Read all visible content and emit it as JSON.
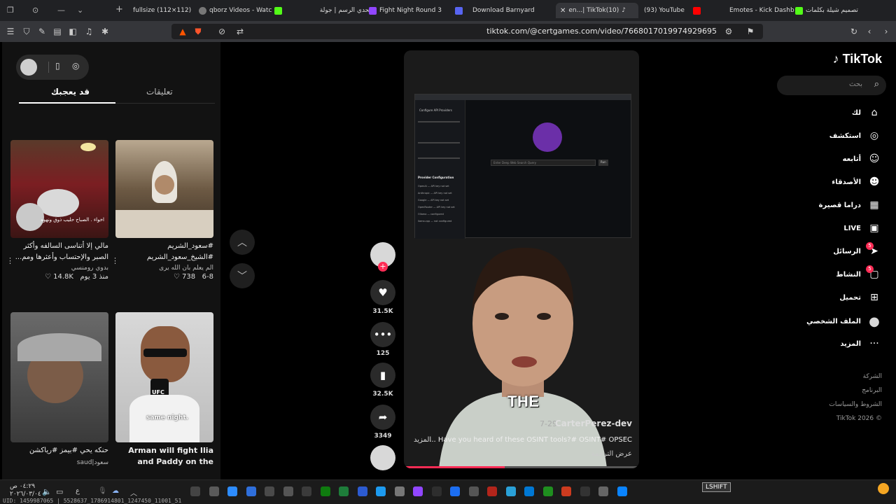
{
  "tabs": [
    {
      "title": "fullsize (112×112)",
      "active": false
    },
    {
      "title": "qborz Videos - Watc",
      "active": false
    },
    {
      "title": "تحدي الرسم | جولة",
      "active": false
    },
    {
      "title": "Fight Night Round 3",
      "active": false
    },
    {
      "title": "Download Barnyard",
      "active": false
    },
    {
      "title": "en...| TikTok(10)",
      "active": true
    },
    {
      "title": "(93) YouTube",
      "active": false
    },
    {
      "title": "Emotes - Kick Dashb",
      "active": false
    },
    {
      "title": "تصميم شيلة بكلمات",
      "active": false
    }
  ],
  "toolbar": {
    "url": "tiktok.com/@certgames.com/video/7668017019974929695"
  },
  "left_panel": {
    "tab_comments": "تعليقات",
    "tab_you_may_like": "قد يعجبك",
    "cards": [
      {
        "caption": "#سعود_الشريم #الشيخ_سعود_الشريم #النفس...",
        "author": "الم يعلم بان الله يرى",
        "likes": "738",
        "date": "6-8"
      },
      {
        "caption": "مالي إلا أتناسى السالفه وأكثر الصبر والإحتساب وأعثرها ومم...",
        "author": "بدوي رومنسي",
        "likes": "14.8K",
        "date": "منذ 3 يوم"
      },
      {
        "caption": "Arman will fight Ilia and Paddy on the same...",
        "author": "",
        "likes": "",
        "date": ""
      },
      {
        "caption": "حنكه يحي #بيمز #رياكشن",
        "author": "سعود|saud",
        "likes": "",
        "date": ""
      }
    ],
    "thumb_texts": {
      "card2": "اخواء . الصباح حليب ذوق ونهوه",
      "card3": "same night.",
      "card3_brand": "UFC"
    }
  },
  "video": {
    "author": "CarterPerez-dev",
    "date": "7-29",
    "description": "Have you heard of these OSINT tools?# OSINT# OPSEC ...",
    "more": "المزيد",
    "translation": "عرض الترجمة",
    "subtitle": "THE",
    "progress": 0.43,
    "screen": {
      "sidebar_title": "Configure API Providers",
      "provider_heading": "Provider Configuration",
      "providers": [
        "OpenAI — API key not set",
        "Anthropic — API key not set",
        "Google — API key not set",
        "OpenRouter — API key not set",
        "Ollama — configured",
        "llama.cpp — not configured"
      ],
      "search_placeholder": "Enter Deep Web Search Query",
      "search_button": "Run"
    }
  },
  "actions": {
    "likes": "31.5K",
    "comments": "125",
    "saves": "32.5K",
    "shares": "3349"
  },
  "sidebar": {
    "brand": "TikTok",
    "search_placeholder": "بحث",
    "items": [
      {
        "label": "لك",
        "icon": "home-icon",
        "badge": ""
      },
      {
        "label": "استكشف",
        "icon": "compass-icon",
        "badge": ""
      },
      {
        "label": "أتابعه",
        "icon": "following-icon",
        "badge": ""
      },
      {
        "label": "الأصدقاء",
        "icon": "friends-icon",
        "badge": ""
      },
      {
        "label": "دراما قصيرة",
        "icon": "drama-icon",
        "badge": ""
      },
      {
        "label": "LIVE",
        "icon": "live-icon",
        "badge": ""
      },
      {
        "label": "الرسائل",
        "icon": "messages-icon",
        "badge": "5"
      },
      {
        "label": "النشاط",
        "icon": "activity-icon",
        "badge": "5"
      },
      {
        "label": "تحميل",
        "icon": "upload-icon",
        "badge": ""
      },
      {
        "label": "الملف الشخصي",
        "icon": "profile-avatar",
        "badge": ""
      },
      {
        "label": "المزيد",
        "icon": "more-icon",
        "badge": ""
      }
    ],
    "footer": [
      "الشركة",
      "البرنامج",
      "الشروط والسياسات",
      "TikTok 2026 ©"
    ]
  },
  "taskbar": {
    "time": "٠٤:٢٩ ص",
    "date": "٢٠٢٦/٠٣/٠٤",
    "lang": "ع",
    "debug": "UID: 1459987065 | 5528637_1786914801_1247450_11001_51",
    "shift_label": "LSHIFT"
  },
  "colors": {
    "accent": "#fe2c55",
    "background": "#000000",
    "panel": "#121212"
  }
}
